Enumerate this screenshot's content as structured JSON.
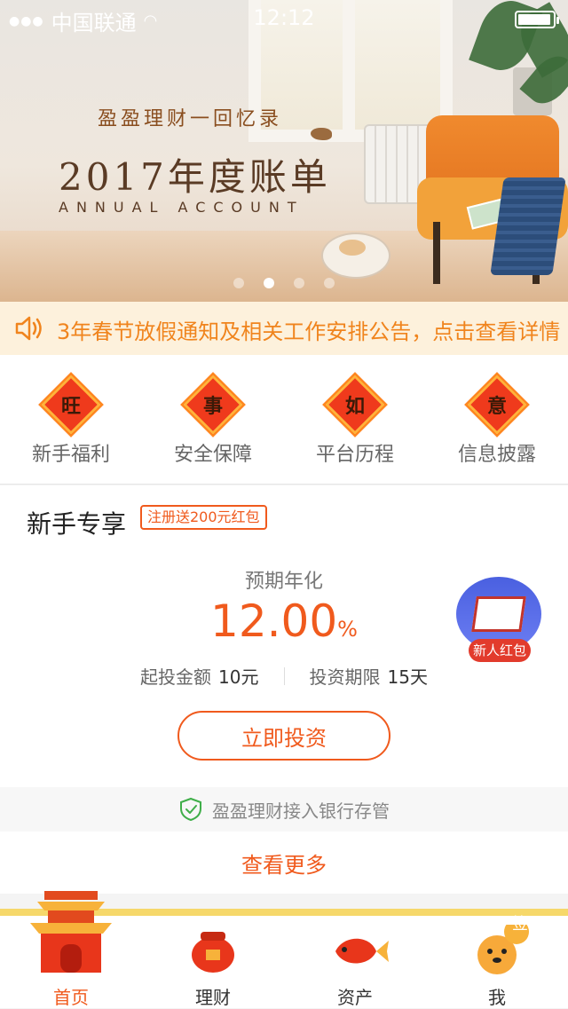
{
  "status_bar": {
    "carrier": "中国联通",
    "time": "12:12"
  },
  "banner": {
    "subtitle": "盈盈理财一回忆录",
    "title": "2017年度账单",
    "title_en": "ANNUAL ACCOUNT",
    "dot_count": 4,
    "active_dot": 2
  },
  "notice": {
    "icon": "speaker-icon",
    "text": "3年春节放假通知及相关工作安排公告，点击查看详情"
  },
  "quick_menu": [
    {
      "char": "旺",
      "label": "新手福利"
    },
    {
      "char": "事",
      "label": "安全保障"
    },
    {
      "char": "如",
      "label": "平台历程"
    },
    {
      "char": "意",
      "label": "信息披露"
    }
  ],
  "product": {
    "title": "新手专享",
    "badge": "注册送200元红包",
    "rate_label": "预期年化",
    "rate_value": "12.00",
    "rate_unit": "%",
    "min_label": "起投金额",
    "min_value": "10元",
    "term_label": "投资期限",
    "term_value": "15天",
    "button": "立即投资",
    "redpacket_label": "新人红包"
  },
  "custody": {
    "text": "盈盈理财接入银行存管"
  },
  "more": {
    "text": "查看更多"
  },
  "tabbar": [
    {
      "label": "首页",
      "icon": "palace-icon",
      "active": true
    },
    {
      "label": "理财",
      "icon": "money-bag-icon",
      "active": false
    },
    {
      "label": "资产",
      "icon": "koi-fish-icon",
      "active": false
    },
    {
      "label": "我",
      "icon": "sign-in-dog-icon",
      "active": false,
      "badge": "签"
    }
  ],
  "colors": {
    "accent": "#f05a1d",
    "notice_text": "#f0841d",
    "notice_bg": "#fdf1dc"
  }
}
